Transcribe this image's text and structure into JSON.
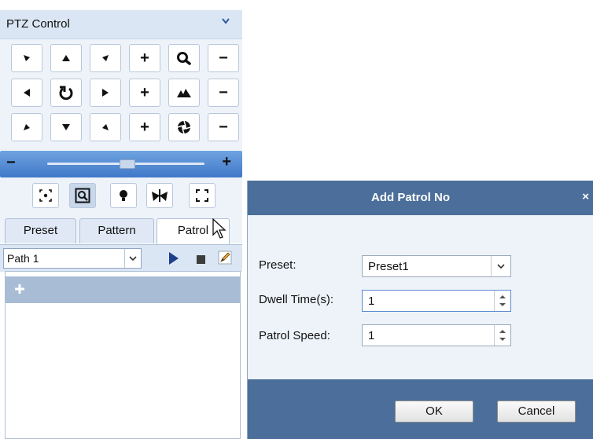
{
  "ptz": {
    "title": "PTZ Control",
    "tabs": [
      {
        "label": "Preset"
      },
      {
        "label": "Pattern"
      },
      {
        "label": "Patrol"
      }
    ],
    "path_select": {
      "value": "Path 1"
    },
    "icons": {
      "direction_pad": [
        "arrow-up-left-icon",
        "arrow-up-icon",
        "arrow-up-right-icon",
        "arrow-left-icon",
        "auto-scan-icon",
        "arrow-right-icon",
        "arrow-down-left-icon",
        "arrow-down-icon",
        "arrow-down-right-icon"
      ],
      "lens": [
        "zoom-icon",
        "focus-icon",
        "iris-icon"
      ],
      "tools": [
        "3d-positioning-icon",
        "zoom-area-icon",
        "light-icon",
        "wiper-icon",
        "manual-track-icon"
      ]
    }
  },
  "dialog": {
    "title": "Add Patrol No",
    "close_glyph": "×",
    "fields": {
      "preset": {
        "label": "Preset:",
        "value": "Preset1"
      },
      "dwell": {
        "label": "Dwell Time(s):",
        "value": "1"
      },
      "speed": {
        "label": "Patrol Speed:",
        "value": "1"
      }
    },
    "ok_label": "OK",
    "cancel_label": "Cancel"
  },
  "colors": {
    "header_blue": "#dbe6f4",
    "dialog_bar": "#4b6f9a",
    "speed_bar": "#4f86d0"
  }
}
